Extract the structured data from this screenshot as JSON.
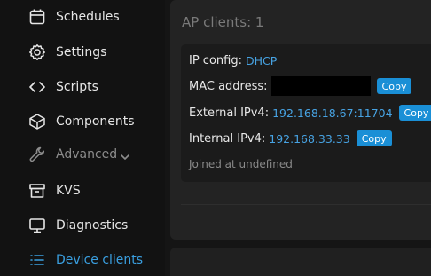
{
  "sidebar": {
    "items": [
      {
        "label": "Schedules",
        "icon": "calendar-icon"
      },
      {
        "label": "Settings",
        "icon": "gear-icon"
      },
      {
        "label": "Scripts",
        "icon": "code-icon"
      },
      {
        "label": "Components",
        "icon": "cube-icon"
      },
      {
        "label": "Advanced",
        "icon": "wrench-icon"
      },
      {
        "label": "KVS",
        "icon": "archive-box-icon"
      },
      {
        "label": "Diagnostics",
        "icon": "monitor-icon"
      },
      {
        "label": "Device clients",
        "icon": "list-icon"
      }
    ]
  },
  "main": {
    "title": "AP clients: 1",
    "client": {
      "ip_config_label": "IP config:",
      "ip_config_value": "DHCP",
      "mac_label": "MAC address:",
      "external_label": "External IPv4:",
      "external_value": "192.168.18.67:11704",
      "internal_label": "Internal IPv4:",
      "internal_value": "192.168.33.33",
      "copy_label": "Copy",
      "joined_text": "Joined at undefined"
    }
  },
  "colors": {
    "accent": "#3a9fe0",
    "copy_button": "#1a8fd6",
    "background": "#121212"
  }
}
